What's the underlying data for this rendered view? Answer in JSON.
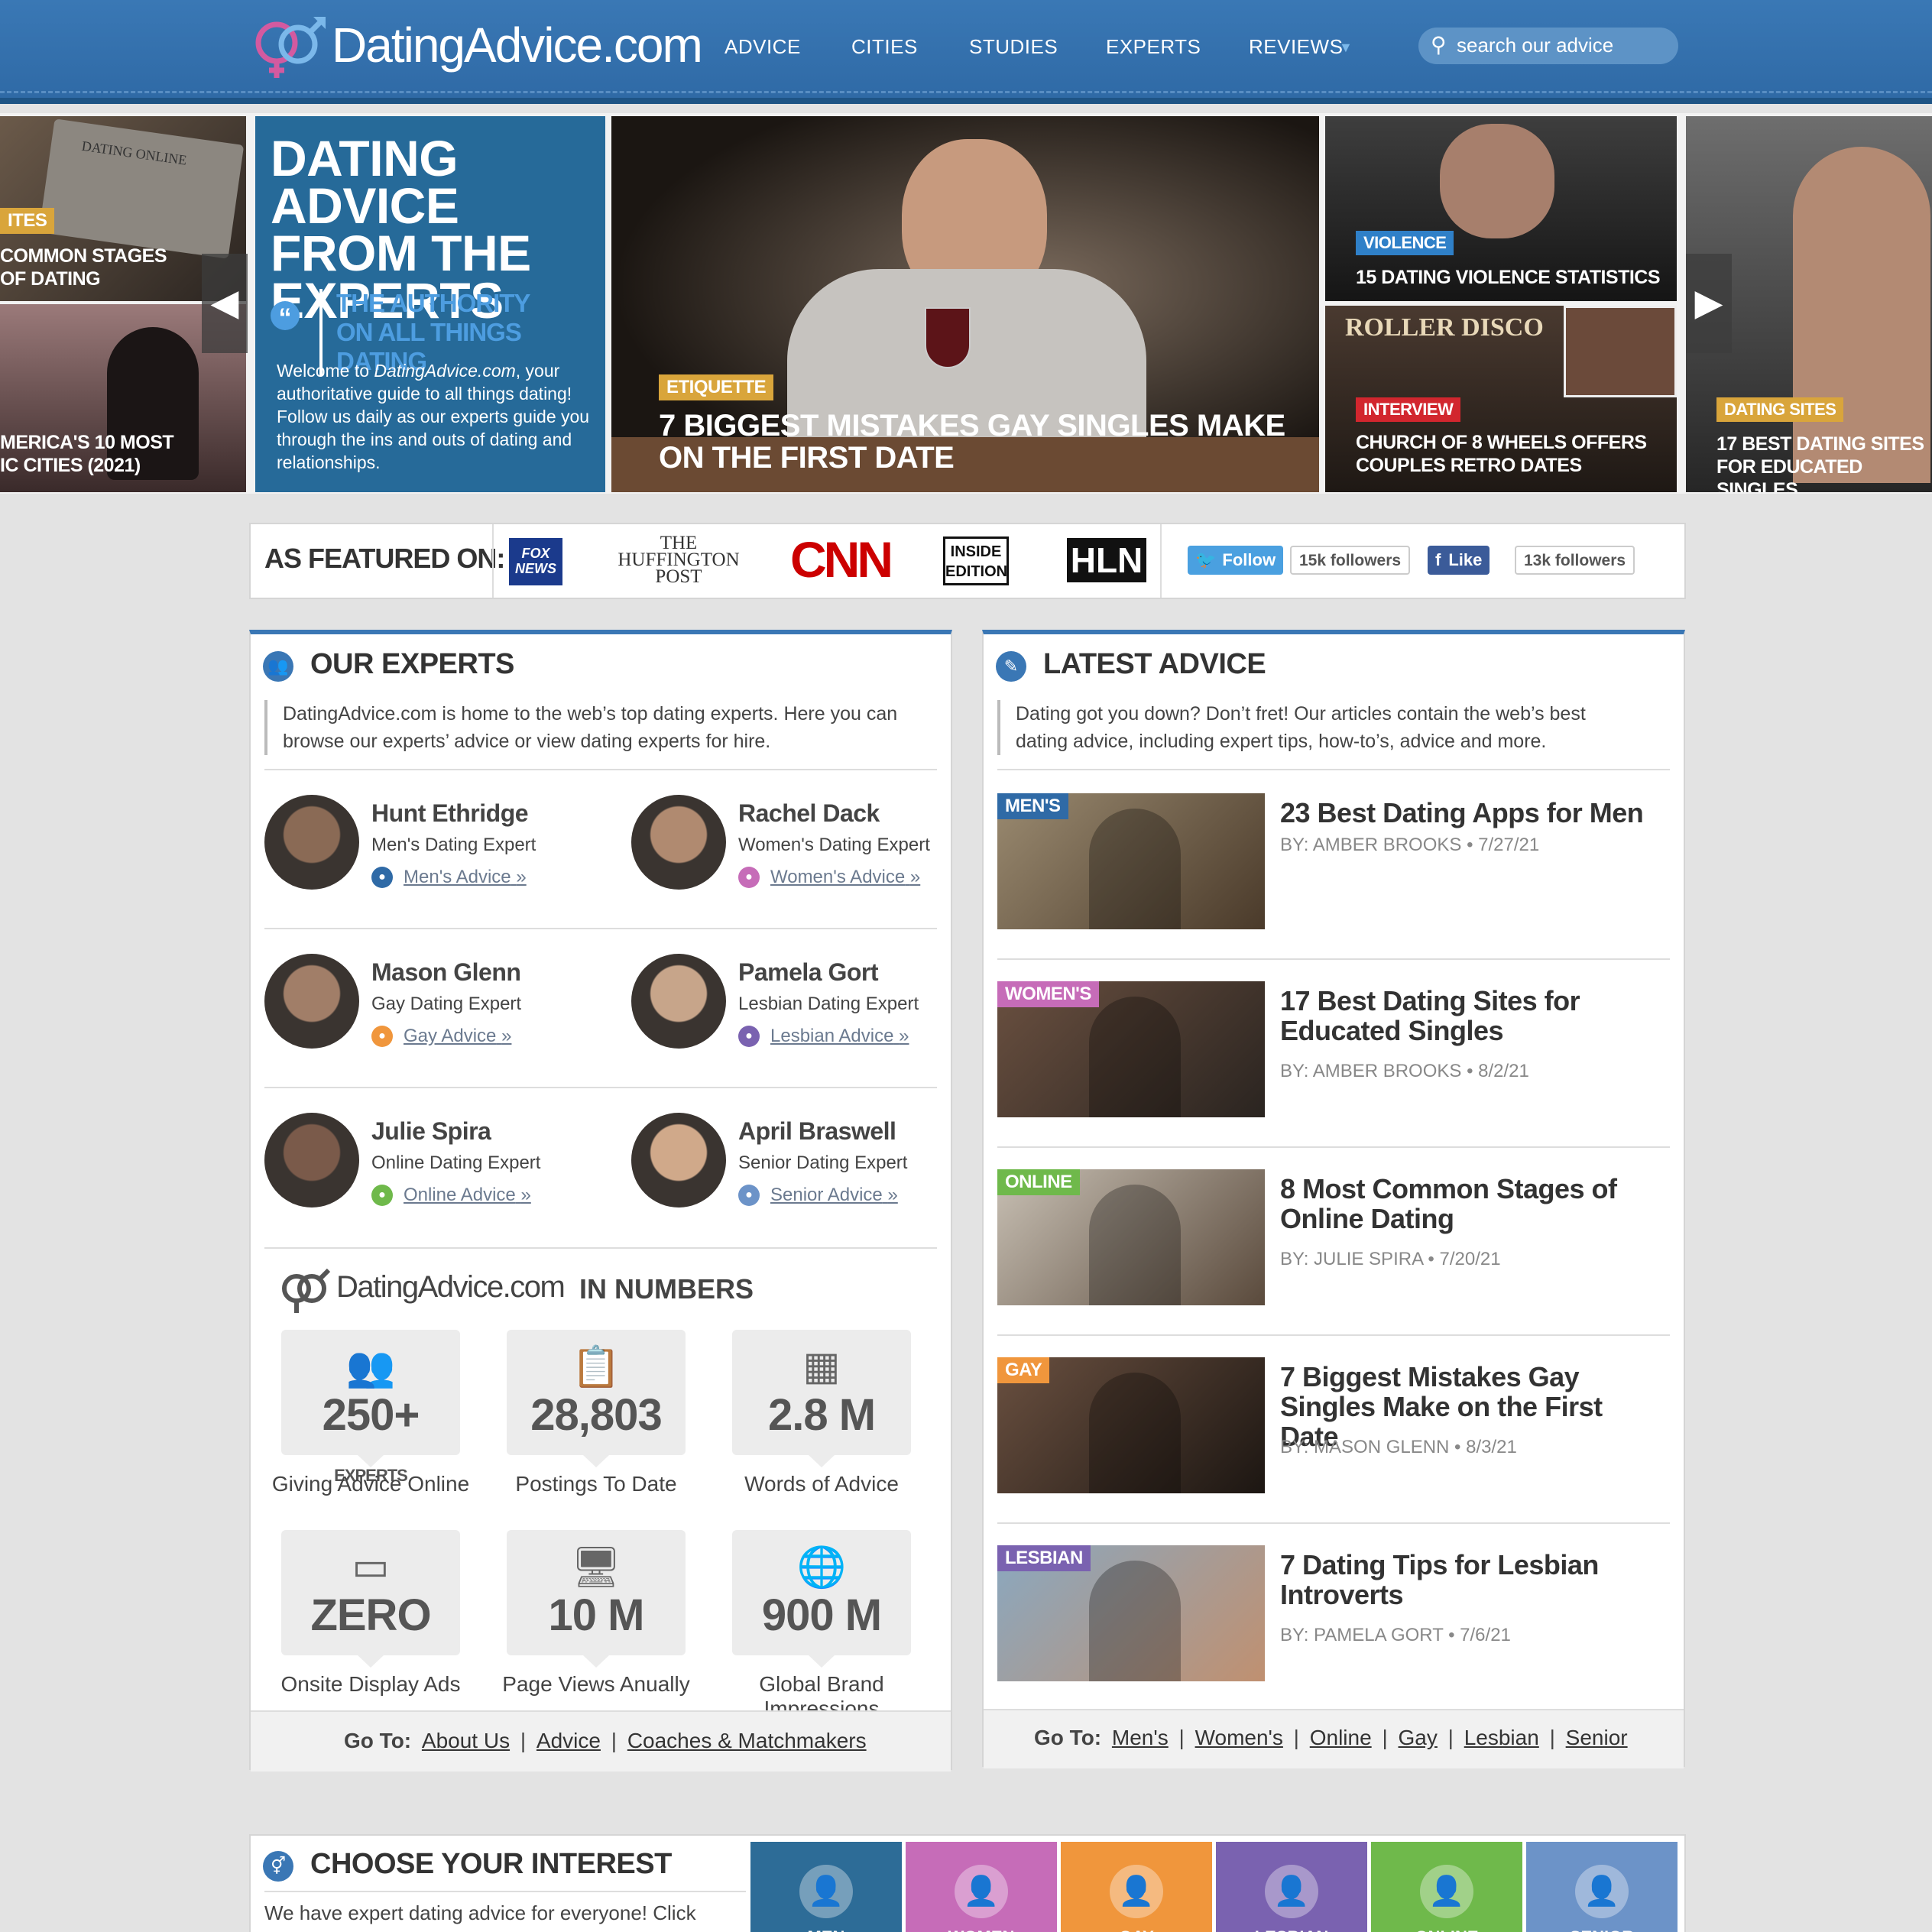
{
  "header": {
    "logo": "DatingAdvice.com",
    "nav": [
      "ADVICE",
      "CITIES",
      "STUDIES",
      "EXPERTS",
      "REVIEWS"
    ],
    "search_placeholder": "search our advice"
  },
  "hero": {
    "left_tile_1": "COMMON STAGES OF DATING",
    "left_tile_1_tag": "ITES",
    "left_tile_2": "MERICA'S 10 MOST IC CITIES (2021)",
    "promo_title": "DATING ADVICE FROM THE EXPERTS",
    "promo_quote": "THE AUTHORITY ON ALL THINGS DATING",
    "promo_body_prefix": "Welcome to ",
    "promo_body_site": "DatingAdvice.com",
    "promo_body": ", your authoritative guide to all things dating! Follow us daily as our experts guide you through the ins and outs of dating and relationships.",
    "main_tag": "ETIQUETTE",
    "main_caption": "7 BIGGEST MISTAKES GAY SINGLES MAKE ON THE FIRST DATE",
    "right_top_tag": "VIOLENCE",
    "right_top_caption": "15 DATING VIOLENCE STATISTICS",
    "right_bottom_tag": "INTERVIEW",
    "right_bottom_caption": "CHURCH OF 8 WHEELS OFFERS COUPLES RETRO DATES",
    "right_bottom_sign": "ROLLER DISCO",
    "far_right_tag": "DATING SITES",
    "far_right_caption": "17 BEST DATING SITES FOR EDUCATED SINGLES",
    "laptop_text": "DATING ONLINE"
  },
  "featured": {
    "label": "AS FEATURED ON:",
    "logos": [
      "FOX NEWS",
      "THE HUFFINGTON POST",
      "CNN",
      "INSIDE EDITION",
      "HLN"
    ],
    "twitter_button": "Follow",
    "twitter_count": "15k followers",
    "facebook_button": "Like",
    "facebook_count": "13k followers"
  },
  "experts": {
    "title": "OUR EXPERTS",
    "intro": "DatingAdvice.com is home to the web’s top dating experts. Here you can browse our experts’ advice or view dating experts for hire.",
    "list": [
      {
        "name": "Hunt Ethridge",
        "role": "Men's Dating Expert",
        "link": "Men's Advice",
        "color": "#2f6aa6"
      },
      {
        "name": "Rachel Dack",
        "role": "Women's Dating Expert",
        "link": "Women's Advice",
        "color": "#c66cb8"
      },
      {
        "name": "Mason Glenn",
        "role": "Gay Dating Expert",
        "link": "Gay Advice",
        "color": "#f0963c"
      },
      {
        "name": "Pamela Gort",
        "role": "Lesbian Dating Expert",
        "link": "Lesbian Advice",
        "color": "#7a62b0"
      },
      {
        "name": "Julie Spira",
        "role": "Online Dating Expert",
        "link": "Online Advice",
        "color": "#6fb94b"
      },
      {
        "name": "April Braswell",
        "role": "Senior Dating Expert",
        "link": "Senior Advice",
        "color": "#6c93c8"
      }
    ],
    "numbers_logo": "DatingAdvice.com",
    "numbers_title": "IN NUMBERS",
    "stats": [
      {
        "value": "250+",
        "suffix": "EXPERTS",
        "label": "Giving Advice Online",
        "icon": "users-icon"
      },
      {
        "value": "28,803",
        "suffix": "",
        "label": "Postings To Date",
        "icon": "clipboard-icon"
      },
      {
        "value": "2.8 M",
        "suffix": "",
        "label": "Words of Advice",
        "icon": "calculator-icon"
      },
      {
        "value": "ZERO",
        "suffix": "",
        "label": "Onsite Display Ads",
        "icon": "browser-icon"
      },
      {
        "value": "10 M",
        "suffix": "",
        "label": "Page Views Anually",
        "icon": "monitor-icon"
      },
      {
        "value": "900 M",
        "suffix": "",
        "label": "Global Brand Impressions",
        "icon": "globe-icon"
      }
    ],
    "goto_label": "Go To:",
    "goto_links": [
      "About Us",
      "Advice",
      "Coaches & Matchmakers"
    ]
  },
  "latest": {
    "title": "LATEST ADVICE",
    "intro": "Dating got you down? Don’t fret! Our articles contain the web’s best dating advice, including expert tips, how-to’s, advice and more.",
    "articles": [
      {
        "tag": "MEN'S",
        "title": "23 Best Dating Apps for Men",
        "by": "BY: AMBER BROOKS • 7/27/21",
        "color": "#2f6aa6"
      },
      {
        "tag": "WOMEN'S",
        "title": "17 Best Dating Sites for Educated Singles",
        "by": "BY: AMBER BROOKS • 8/2/21",
        "color": "#c66cb8"
      },
      {
        "tag": "ONLINE",
        "title": "8 Most Common Stages of Online Dating",
        "by": "BY: JULIE SPIRA • 7/20/21",
        "color": "#6fb94b"
      },
      {
        "tag": "GAY",
        "title": "7 Biggest Mistakes Gay Singles Make on the First Date",
        "by": "BY: MASON GLENN • 8/3/21",
        "color": "#f0963c"
      },
      {
        "tag": "LESBIAN",
        "title": "7 Dating Tips for Lesbian Introverts",
        "by": "BY: PAMELA GORT • 7/6/21",
        "color": "#7a62b0"
      }
    ],
    "goto_label": "Go To:",
    "goto_links": [
      "Men's",
      "Women's",
      "Online",
      "Gay",
      "Lesbian",
      "Senior"
    ]
  },
  "interest": {
    "title": "CHOOSE YOUR INTEREST",
    "intro": "We have expert dating advice for everyone! Click",
    "categories": [
      {
        "label": "MEN",
        "color": "#2d6c97"
      },
      {
        "label": "WOMEN",
        "color": "#c66cb8"
      },
      {
        "label": "GAY",
        "color": "#f0963c"
      },
      {
        "label": "LESBIAN",
        "color": "#7a62b0"
      },
      {
        "label": "ONLINE",
        "color": "#6fb94b"
      },
      {
        "label": "SENIOR",
        "color": "#6c93c8"
      }
    ]
  }
}
